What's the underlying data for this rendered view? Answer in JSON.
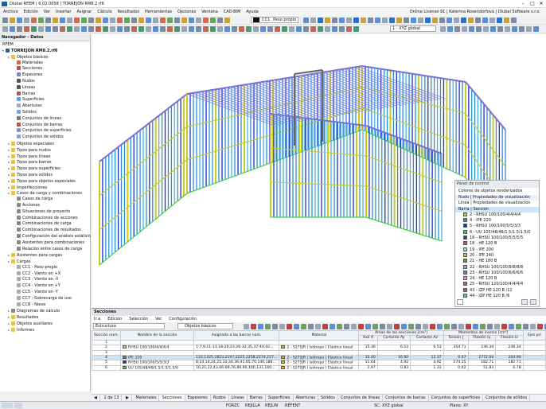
{
  "window": {
    "title": "Dlubal RFEM | 6.02.0058 | TORREJON RM8.2.rf6",
    "min": "–",
    "max": "□",
    "close": "✕"
  },
  "menu": [
    "Archivo",
    "Edición",
    "Ver",
    "Insertar",
    "Asignar",
    "Cálculo",
    "Resultados",
    "Herramientas",
    "Opciones",
    "Ventana",
    "CAD-BIM",
    "Ayuda"
  ],
  "license": "Online License 91 | Katerina Rosendorfová | Dlubal Software s.r.o.",
  "toolbar": {
    "lc_code": "CC1",
    "lc_name": "Peso propio",
    "view": "1 - XYZ global"
  },
  "navigator": {
    "title": "Navegador - Datos",
    "root": "RFEM",
    "file": "TORREJON RM8.2.rf6",
    "items": [
      {
        "label": "Objetos básicos",
        "level": 1,
        "icon": "folder-icon",
        "color": "#e8c34a"
      },
      {
        "label": "Materiales",
        "level": 2,
        "icon": "material-icon",
        "color": "#d86a2b"
      },
      {
        "label": "Secciones",
        "level": 2,
        "icon": "section-icon",
        "color": "#c94b4b"
      },
      {
        "label": "Espesores",
        "level": 2,
        "icon": "thickness-icon",
        "color": "#6a8bc9"
      },
      {
        "label": "Nudos",
        "level": 2,
        "icon": "node-icon",
        "color": "#555555"
      },
      {
        "label": "Líneas",
        "level": 2,
        "icon": "line-icon",
        "color": "#555555"
      },
      {
        "label": "Barras",
        "level": 2,
        "icon": "member-icon",
        "color": "#c94b4b"
      },
      {
        "label": "Superficies",
        "level": 2,
        "icon": "surface-icon",
        "color": "#6a9bd8"
      },
      {
        "label": "Aberturas",
        "level": 2,
        "icon": "opening-icon",
        "color": "#9ab0d0"
      },
      {
        "label": "Sólidos",
        "level": 2,
        "icon": "solid-icon",
        "color": "#7aa5d6"
      },
      {
        "label": "Conjuntos de líneas",
        "level": 2,
        "icon": "lineset-icon",
        "color": "#777777"
      },
      {
        "label": "Conjuntos de barras",
        "level": 2,
        "icon": "memberset-icon",
        "color": "#c94b4b"
      },
      {
        "label": "Conjuntos de superficies",
        "level": 2,
        "icon": "surfaceset-icon",
        "color": "#6a9bd8"
      },
      {
        "label": "Conjuntos de sólidos",
        "level": 2,
        "icon": "solidset-icon",
        "color": "#7aa5d6"
      },
      {
        "label": "Objetos especiales",
        "level": 1,
        "icon": "folder-icon",
        "color": "#e8c34a"
      },
      {
        "label": "Tipos para nudos",
        "level": 1,
        "icon": "folder-icon",
        "color": "#e8c34a"
      },
      {
        "label": "Tipos para líneas",
        "level": 1,
        "icon": "folder-icon",
        "color": "#e8c34a"
      },
      {
        "label": "Tipos para barras",
        "level": 1,
        "icon": "folder-icon",
        "color": "#e8c34a"
      },
      {
        "label": "Tipos para superficies",
        "level": 1,
        "icon": "folder-icon",
        "color": "#e8c34a"
      },
      {
        "label": "Tipos para sólidos",
        "level": 1,
        "icon": "folder-icon",
        "color": "#e8c34a"
      },
      {
        "label": "Tipos para objetos especiales",
        "level": 1,
        "icon": "folder-icon",
        "color": "#e8c34a"
      },
      {
        "label": "Imperfecciones",
        "level": 1,
        "icon": "folder-icon",
        "color": "#e8c34a"
      },
      {
        "label": "Casos de carga y combinaciones",
        "level": 1,
        "icon": "folder-icon",
        "color": "#e8c34a"
      },
      {
        "label": "Casos de carga",
        "level": 2,
        "icon": "loadcase-icon",
        "color": "#888888"
      },
      {
        "label": "Acciones",
        "level": 2,
        "icon": "action-icon",
        "color": "#888888"
      },
      {
        "label": "Situaciones de proyecto",
        "level": 2,
        "icon": "design-situation-icon",
        "color": "#888888"
      },
      {
        "label": "Combinaciones de acciones",
        "level": 2,
        "icon": "action-combination-icon",
        "color": "#888888"
      },
      {
        "label": "Combinaciones de carga",
        "level": 2,
        "icon": "load-combination-icon",
        "color": "#888888"
      },
      {
        "label": "Combinaciones de resultados",
        "level": 2,
        "icon": "result-combination-icon",
        "color": "#888888"
      },
      {
        "label": "Configuración del análisis estático",
        "level": 2,
        "icon": "static-settings-icon",
        "color": "#888888"
      },
      {
        "label": "Asistentes para combinaciones",
        "level": 2,
        "icon": "combination-wizard-icon",
        "color": "#888888"
      },
      {
        "label": "Relación entre casos de carga",
        "level": 2,
        "icon": "relationship-icon",
        "color": "#888888"
      },
      {
        "label": "Asistentes para cargas",
        "level": 1,
        "icon": "folder-icon",
        "color": "#e8c34a"
      },
      {
        "label": "Cargas",
        "level": 1,
        "icon": "folder-icon",
        "color": "#e8c34a"
      },
      {
        "label": "CC1 - Peso propio",
        "level": 2,
        "icon": "load-icon",
        "color": "#aaaaaa"
      },
      {
        "label": "CC2 - Viento en +X",
        "level": 2,
        "icon": "load-icon",
        "color": "#aaaaaa"
      },
      {
        "label": "CC3 - Viento en -X",
        "level": 2,
        "icon": "load-icon",
        "color": "#aaaaaa"
      },
      {
        "label": "CC4 - Viento en +Y",
        "level": 2,
        "icon": "load-icon",
        "color": "#aaaaaa"
      },
      {
        "label": "CC5 - Viento en -Y",
        "level": 2,
        "icon": "load-icon",
        "color": "#aaaaaa"
      },
      {
        "label": "CC7 - Sobrecarga de uso",
        "level": 2,
        "icon": "load-icon",
        "color": "#aaaaaa"
      },
      {
        "label": "CC8 - Nieve",
        "level": 2,
        "icon": "load-icon",
        "color": "#aaaaaa"
      },
      {
        "label": "Diagramas de cálculo",
        "level": 1,
        "icon": "diagram-icon",
        "color": "#888888"
      },
      {
        "label": "Resultados",
        "level": 1,
        "icon": "folder-icon",
        "color": "#e8c34a"
      },
      {
        "label": "Objetos auxiliares",
        "level": 1,
        "icon": "folder-icon",
        "color": "#e8c34a"
      },
      {
        "label": "Informes",
        "level": 1,
        "icon": "folder-icon",
        "color": "#e8c34a"
      }
    ]
  },
  "control_panel": {
    "title": "Panel de control",
    "subtitle": "Colores de objetos renderizados",
    "options": [
      "Nudo | Propiedades de visualización",
      "Línea | Propiedades de visualización",
      "Barra | Sección"
    ],
    "entries": [
      {
        "label": "2 - RHSU 100/100/4/4/4/4",
        "color": "#c9c928"
      },
      {
        "label": "4 - IPE 220",
        "color": "#2b8fd8"
      },
      {
        "label": "5 - RHSU 100/100/5/5/3/3",
        "color": "#1a2fd1"
      },
      {
        "label": "6 - UU 105/48/48/1.5/1.5/1.5/0",
        "color": "#3bd33b"
      },
      {
        "label": "16 - RHSU 100/100/5/5/5/5",
        "color": "#1f3f9a"
      },
      {
        "label": "18 - HE 120 B",
        "color": "#e05050"
      },
      {
        "label": "19 - IPE 200",
        "color": "#9ad6e8"
      },
      {
        "label": "20 - IPE 240",
        "color": "#f0c000"
      },
      {
        "label": "21 - HE 180 B",
        "color": "#40a040"
      },
      {
        "label": "22 - RHSU 100/100/8/8/8/8",
        "color": "#a0a0ff"
      },
      {
        "label": "23 - RHSU 100/100/6/6/6/6",
        "color": "#8a6ad0"
      },
      {
        "label": "24 - HE 120 B",
        "color": "#e890e8"
      },
      {
        "label": "25 - RHSU 120/100/4/4/4/4",
        "color": "#e8409a"
      },
      {
        "label": "43 - IZP HE 120 B /12",
        "color": "#c06030"
      },
      {
        "label": "44 - IZP HE 120 B /6",
        "color": "#60c0c0"
      }
    ]
  },
  "sections": {
    "title": "Secciones",
    "menu": [
      "Ir a",
      "Edición",
      "Selección",
      "Ver",
      "Configuración"
    ],
    "filter1": "Estructura",
    "filter2": "Objetos básicos",
    "header_group1": "Áreas de las secciones [cm²]",
    "header_group2": "Momentos de inercia [cm⁴]",
    "header_group3": "Ejes pri",
    "columns": [
      "Sección núm.",
      "Nombre de la sección",
      "Asignada a las barras núm.",
      "Material",
      "Axil A",
      "Cortante Ay",
      "Cortante Az",
      "Torsión J",
      "Flexión Iy",
      "Flexión Iz"
    ],
    "rows": [
      {
        "no": "1",
        "name": "",
        "members": "",
        "material": "",
        "a": "",
        "ay": "",
        "az": "",
        "j": "",
        "iy": "",
        "iz": "",
        "color": "#ffffff",
        "mcolor": "#ffffff"
      },
      {
        "no": "2",
        "name": "RHSU 100/100/4/4/4/4",
        "members": "1-7,9,11-13,18-20,23,26-32,35,37-40,42...",
        "material": "2 - S275JR | Isótropo | Elástico lineal",
        "a": "15.36",
        "ay": "6.53",
        "az": "6.53",
        "j": "354.71",
        "iy": "236.34",
        "iz": "236.34",
        "color": "#c9c928",
        "mcolor": "#e8b020"
      },
      {
        "no": "3",
        "name": "",
        "members": "",
        "material": "",
        "a": "",
        "ay": "",
        "az": "",
        "j": "",
        "iy": "",
        "iz": "",
        "color": "#ffffff",
        "mcolor": "#ffffff"
      },
      {
        "no": "4",
        "name": "IPE 220",
        "members": "133,1325,1823,2197,2225,2258,2274,227...",
        "material": "2 - S275JR | Isótropo | Elástico lineal",
        "a": "33.40",
        "ay": "16.60",
        "az": "12.37",
        "j": "9.07",
        "iy": "2772.00",
        "iz": "204.90",
        "color": "#2b8fd8",
        "mcolor": "#e8b020"
      },
      {
        "no": "5",
        "name": "RHSU 100/100/5/5/3/3",
        "members": "8,10,14,24,25,33,34,36,41,65,70,140,186...",
        "material": "2 - S275JR | Isótropo | Elástico lineal",
        "a": "11.64",
        "ay": "4.92",
        "az": "4.92",
        "j": "274.15",
        "iy": "182.71",
        "iz": "182.71",
        "color": "#1a2fd1",
        "mcolor": "#e8b020"
      },
      {
        "no": "6",
        "name": "UU 105/48/48/1.5/1.5/1.5/0",
        "members": "16,21,22,43,66-69,76,89,90,100,131,160...",
        "material": "2 - S275JR | Isótropo | Elástico lineal",
        "a": "2.97",
        "ay": "0.83",
        "az": "1.33",
        "j": "0.02",
        "iy": "51.83",
        "iz": "6.78",
        "color": "#3bd33b",
        "mcolor": "#e8b020"
      }
    ],
    "pager": "2 de 13",
    "tabs": [
      "Materiales",
      "Secciones",
      "Espesores",
      "Nudos",
      "Líneas",
      "Barras",
      "Superficies",
      "Aberturas",
      "Sólidos",
      "Conjuntos de líneas",
      "Conjuntos de barras",
      "Conjuntos de superficies",
      "Conjuntos de sólidos"
    ],
    "active_tab": "Secciones"
  },
  "statusbar": {
    "snap": "FORZC",
    "grid": "REJILLA",
    "osnap": "REJLIN",
    "ref": "REFENT",
    "cs": "SC: XYZ global",
    "plane": "Plano: XY"
  }
}
